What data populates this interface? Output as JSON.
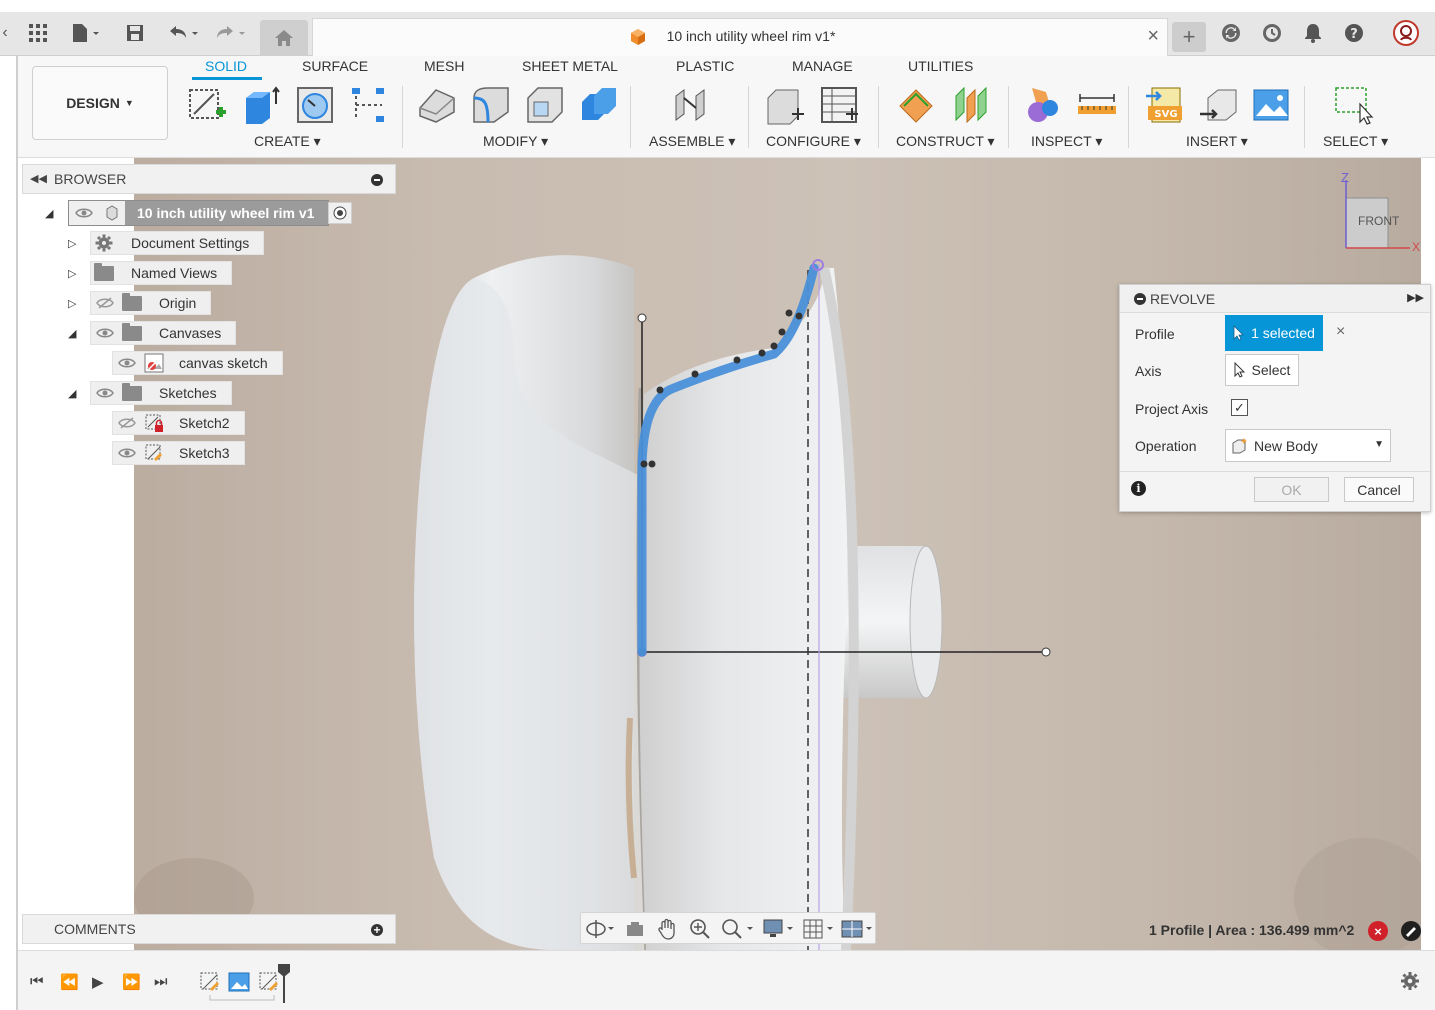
{
  "document": {
    "title": "10 inch utility wheel rim v1*"
  },
  "workspace": {
    "label": "DESIGN",
    "tabs": [
      {
        "label": "SOLID",
        "active": true
      },
      {
        "label": "SURFACE",
        "active": false
      },
      {
        "label": "MESH",
        "active": false
      },
      {
        "label": "SHEET METAL",
        "active": false
      },
      {
        "label": "PLASTIC",
        "active": false
      },
      {
        "label": "MANAGE",
        "active": false
      },
      {
        "label": "UTILITIES",
        "active": false
      }
    ],
    "groups": [
      {
        "label": "CREATE"
      },
      {
        "label": "MODIFY"
      },
      {
        "label": "ASSEMBLE"
      },
      {
        "label": "CONFIGURE"
      },
      {
        "label": "CONSTRUCT"
      },
      {
        "label": "INSPECT"
      },
      {
        "label": "INSERT"
      },
      {
        "label": "SELECT"
      }
    ]
  },
  "browser": {
    "title": "BROWSER",
    "items": [
      {
        "label": "10 inch utility wheel rim v1"
      },
      {
        "label": "Document Settings"
      },
      {
        "label": "Named Views"
      },
      {
        "label": "Origin"
      },
      {
        "label": "Canvases"
      },
      {
        "label": "canvas sketch"
      },
      {
        "label": "Sketches"
      },
      {
        "label": "Sketch2"
      },
      {
        "label": "Sketch3"
      }
    ]
  },
  "revolve": {
    "title": "REVOLVE",
    "profile_label": "Profile",
    "profile_value": "1 selected",
    "axis_label": "Axis",
    "axis_value": "Select",
    "project_axis_label": "Project Axis",
    "project_axis_checked": true,
    "operation_label": "Operation",
    "operation_value": "New Body",
    "ok_label": "OK",
    "cancel_label": "Cancel"
  },
  "viewcube": {
    "face": "FRONT",
    "axis_z": "Z",
    "axis_x": "X"
  },
  "comments": {
    "title": "COMMENTS"
  },
  "status": {
    "text": "1 Profile | Area : 136.499 mm^2"
  },
  "colors": {
    "accent": "#0696d7",
    "profile_fill": "#4a90d9",
    "error": "#d0202a"
  }
}
